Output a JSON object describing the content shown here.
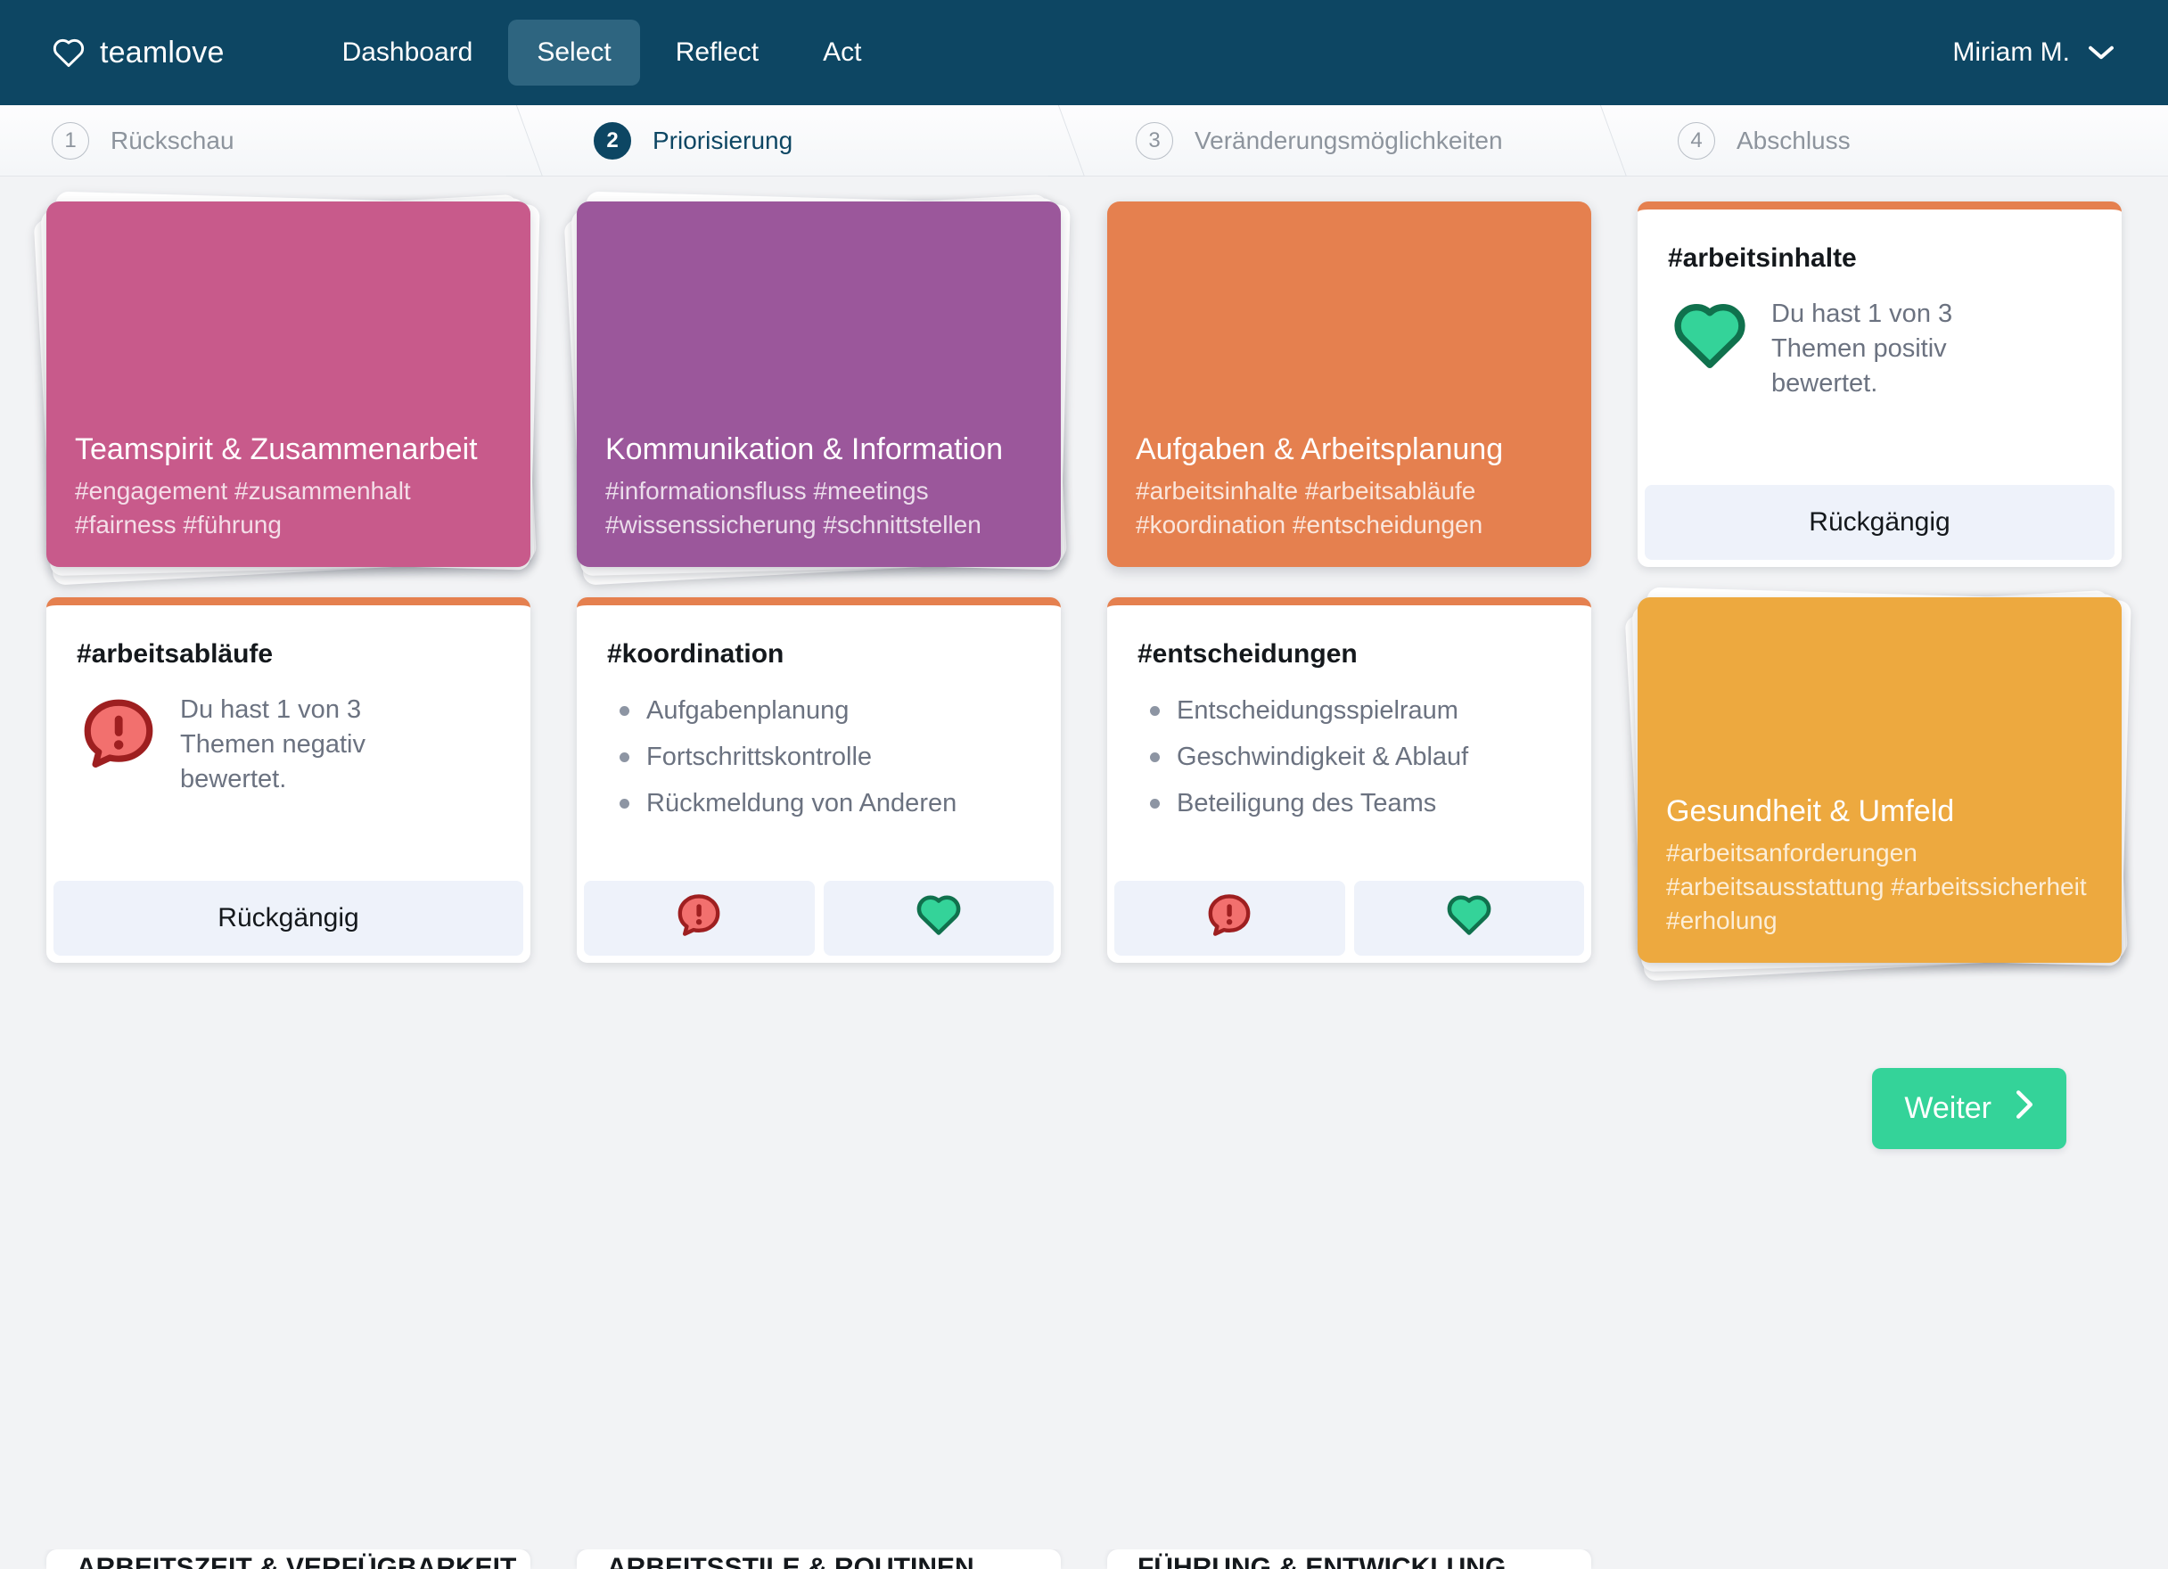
{
  "header": {
    "brand": "teamlove",
    "brand_icon": "heart-outline-icon",
    "nav": [
      {
        "label": "Dashboard",
        "active": false
      },
      {
        "label": "Select",
        "active": true
      },
      {
        "label": "Reflect",
        "active": false
      },
      {
        "label": "Act",
        "active": false
      }
    ],
    "user": {
      "name": "Miriam M.",
      "chevron_icon": "chevron-down-icon"
    },
    "bg_color": "#0d4663",
    "active_tab_bg": "#2e6580"
  },
  "steps": [
    {
      "num": "1",
      "label": "Rückschau",
      "current": false
    },
    {
      "num": "2",
      "label": "Priorisierung",
      "current": true
    },
    {
      "num": "3",
      "label": "Veränderungsmöglichkeiten",
      "current": false
    },
    {
      "num": "4",
      "label": "Abschluss",
      "current": false
    }
  ],
  "cards": [
    {
      "kind": "topic",
      "title": "Teamspirit & Zusammenarbeit",
      "tags": "#engagement #zusammenhalt #fairness #führung",
      "color": "#c85a8b",
      "stacked": true
    },
    {
      "kind": "topic",
      "title": "Kommunikation & Information",
      "tags": "#informationsfluss #meetings #wissenssicherung #schnittstellen",
      "color": "#9b579b",
      "stacked": true
    },
    {
      "kind": "topic",
      "title": "Aufgaben & Arbeitsplanung",
      "tags": "#arbeitsinhalte #arbeitsabläufe #koordination #entscheidungen",
      "color": "#e5804f",
      "stacked": false
    },
    {
      "kind": "rated",
      "hashtag": "#arbeitsinhalte",
      "rating_icon": "heart-filled-icon",
      "rating": "positive",
      "message": "Du hast 1 von 3 Themen positiv bewertet.",
      "undo_label": "Rückgängig",
      "accent": "#e5804f"
    },
    {
      "kind": "rated",
      "hashtag": "#arbeitsabläufe",
      "rating_icon": "alert-bubble-icon",
      "rating": "negative",
      "message": "Du hast 1 von 3 Themen negativ bewertet.",
      "undo_label": "Rückgängig",
      "accent": "#e5804f"
    },
    {
      "kind": "choice",
      "hashtag": "#koordination",
      "topics": [
        "Aufgabenplanung",
        "Fortschrittskontrolle",
        "Rückmeldung von Anderen"
      ],
      "negative_icon": "alert-bubble-icon",
      "positive_icon": "heart-outline-green-icon",
      "accent": "#e5804f"
    },
    {
      "kind": "choice",
      "hashtag": "#entscheidungen",
      "topics": [
        "Entscheidungsspielraum",
        "Geschwindigkeit & Ablauf",
        "Beteiligung des Teams"
      ],
      "negative_icon": "alert-bubble-icon",
      "positive_icon": "heart-outline-green-icon",
      "accent": "#e5804f"
    },
    {
      "kind": "topic",
      "title": "Gesundheit & Umfeld",
      "tags": "#arbeitsanforderungen #arbeitsausstattung #arbeitssicherheit #erholung",
      "color": "#eda93f",
      "stacked": true
    }
  ],
  "footer": {
    "next_label": "Weiter",
    "next_icon": "chevron-right-icon",
    "next_color": "#34d399"
  },
  "peek": [
    {
      "text": "ARBEITSZEIT & VERFÜGBARKEIT"
    },
    {
      "text": "ARBEITSSTILE & ROUTINEN"
    },
    {
      "text": "FÜHRUNG & ENTWICKLUNG"
    },
    {
      "text": ""
    }
  ]
}
